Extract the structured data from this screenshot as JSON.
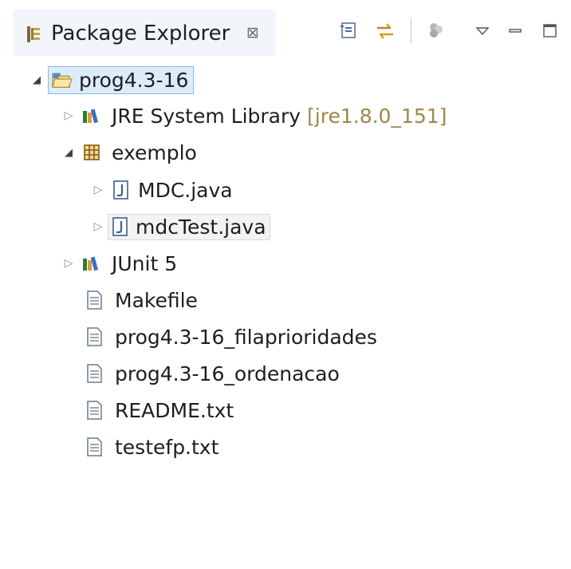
{
  "view": {
    "title": "Package Explorer",
    "close_glyph": "⊠",
    "toolbar": [
      {
        "name": "collapse-all-icon"
      },
      {
        "name": "link-with-editor-icon"
      },
      {
        "name": "filters-icon"
      },
      {
        "name": "view-menu-icon"
      },
      {
        "name": "minimize-icon"
      },
      {
        "name": "maximize-icon"
      }
    ]
  },
  "tree": {
    "project": {
      "label": "prog4.3-16",
      "icon": "open-project-folder-icon",
      "expanded": true
    },
    "jre": {
      "label": "JRE System Library",
      "decoration": "[jre1.8.0_151]",
      "icon": "library-icon"
    },
    "package": {
      "label": "exemplo",
      "icon": "package-icon",
      "expanded": true
    },
    "mdc": {
      "label": "MDC.java",
      "icon": "java-file-icon"
    },
    "mdctest": {
      "label": "mdcTest.java",
      "icon": "java-file-icon"
    },
    "junit": {
      "label": "JUnit 5",
      "icon": "library-icon"
    },
    "makefile": {
      "label": "Makefile",
      "icon": "text-file-icon"
    },
    "fila": {
      "label": "prog4.3-16_filaprioridades",
      "icon": "text-file-icon"
    },
    "ordenacao": {
      "label": "prog4.3-16_ordenacao",
      "icon": "text-file-icon"
    },
    "readme": {
      "label": "README.txt",
      "icon": "text-file-icon"
    },
    "testefp": {
      "label": "testefp.txt",
      "icon": "text-file-icon"
    }
  },
  "colors": {
    "selection_bg": "#dcecfb",
    "selection_border": "#8db8e6",
    "decoration": "#a0874a"
  }
}
